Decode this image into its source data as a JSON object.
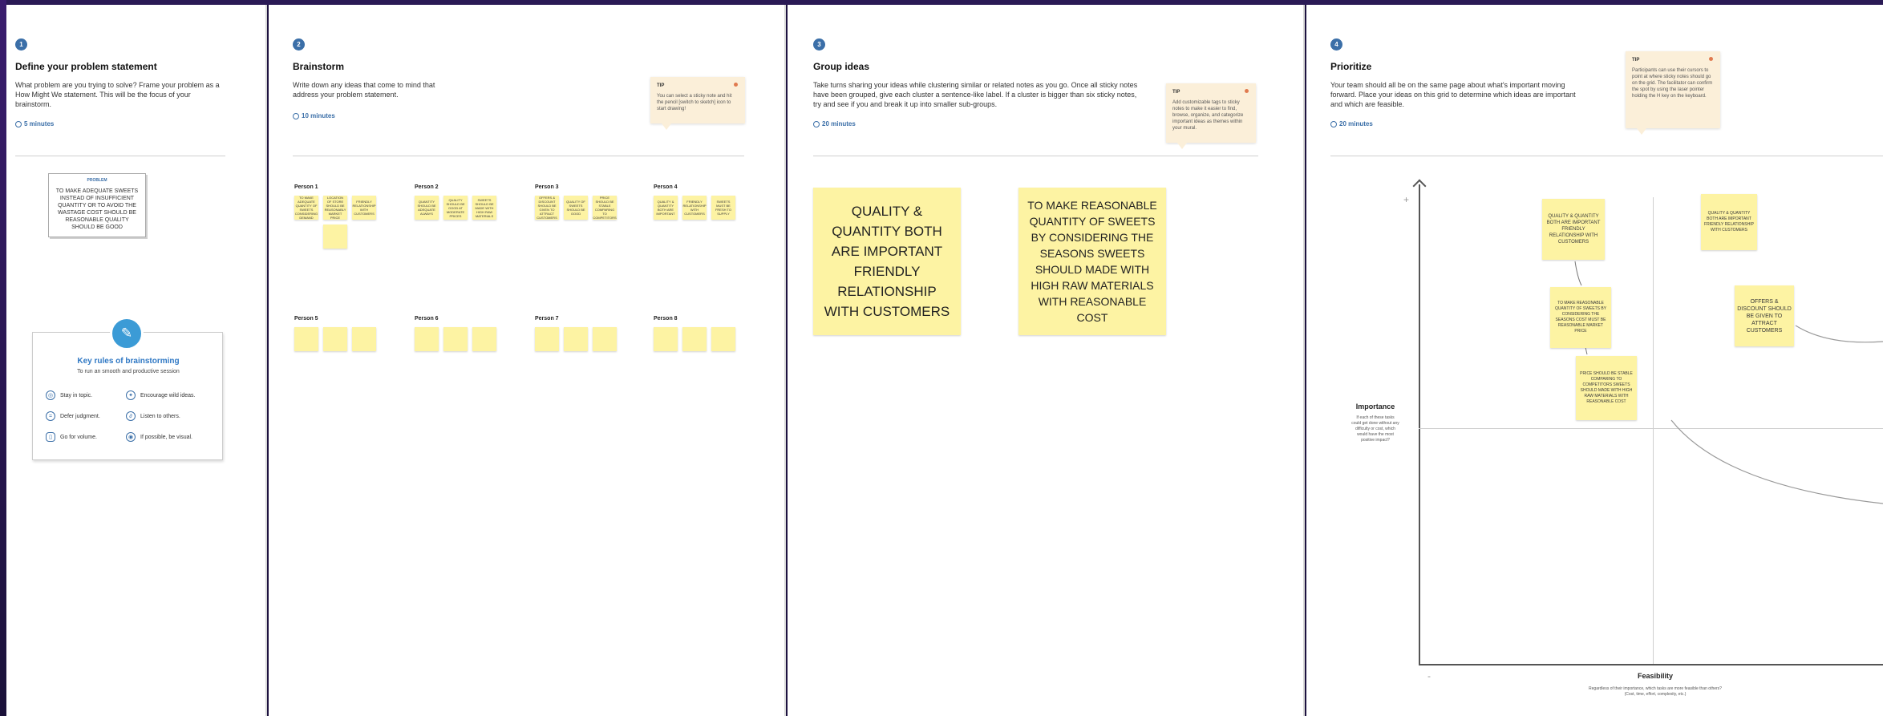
{
  "steps": [
    {
      "number": "1",
      "title": "Define your problem statement",
      "description": "What problem are you trying to solve? Frame your problem as a How Might We statement. This will be the focus of your brainstorm.",
      "time": "5 minutes"
    },
    {
      "number": "2",
      "title": "Brainstorm",
      "description": "Write down any ideas that come to mind that address your problem statement.",
      "time": "10 minutes"
    },
    {
      "number": "3",
      "title": "Group ideas",
      "description": "Take turns sharing your ideas while clustering similar or related notes as you go. Once all sticky notes have been grouped, give each cluster a sentence-like label. If a cluster is bigger than six sticky notes, try and see if you and break it up into smaller sub-groups.",
      "time": "20 minutes"
    },
    {
      "number": "4",
      "title": "Prioritize",
      "description": "Your team should all be on the same page about what's important moving forward. Place your ideas on this grid to determine which ideas are important and which are feasible.",
      "time": "20 minutes"
    }
  ],
  "problem_card": {
    "label": "PROBLEM",
    "text": "TO MAKE ADEQUATE SWEETS INSTEAD OF INSUFFICIENT QUANTITY OR TO AVOID THE WASTAGE COST SHOULD BE REASONABLE QUALITY SHOULD BE GOOD"
  },
  "key_rules": {
    "title": "Key rules of brainstorming",
    "subtitle": "To run an smooth and productive session",
    "rules": [
      {
        "icon": "focus-icon",
        "text": "Stay in topic."
      },
      {
        "icon": "lightbulb-icon",
        "text": "Encourage wild ideas."
      },
      {
        "icon": "pause-icon",
        "text": "Defer judgment."
      },
      {
        "icon": "ear-icon",
        "text": "Listen to others."
      },
      {
        "icon": "volume-icon",
        "text": "Go for volume."
      },
      {
        "icon": "eye-icon",
        "text": "If possible, be visual."
      }
    ]
  },
  "tips": {
    "brainstorm": {
      "label": "TIP",
      "text": "You can select a sticky note and hit the pencil [switch to sketch] icon to start drawing!"
    },
    "group": {
      "label": "TIP",
      "text": "Add customizable tags to sticky notes to make it easier to find, browse, organize, and categorize important ideas as themes within your mural."
    },
    "prioritize": {
      "label": "TIP",
      "text": "Participants can use their cursors to point at where sticky notes should go on the grid. The facilitator can confirm the spot by using the laser pointer holding the H key on the keyboard."
    }
  },
  "persons": [
    {
      "name": "Person 1",
      "notes": [
        "TO MAKE ADEQUATE QUANTITY OF SWEETS CONSIDERING DEMAND",
        "LOCATION OF STORE SHOULD BE REASONABLY MARKET PRICE",
        "FRIENDLY RELATIONSHIP WITH CUSTOMERS",
        ""
      ]
    },
    {
      "name": "Person 2",
      "notes": [
        "QUANTITY SHOULD BE ADEQUATE ALWAYS",
        "QUALITY SHOULD BE GOOD AT MODERATE PRICES",
        "SWEETS SHOULD BE MADE WITH HIGH RAW MATERIALS"
      ]
    },
    {
      "name": "Person 3",
      "notes": [
        "OFFERS & DISCOUNT SHOULD BE GIVEN TO ATTRACT CUSTOMERS",
        "QUALITY OF SWEETS SHOULD BE GOOD",
        "PRICE SHOULD BE STABLE COMPARING TO COMPETITORS"
      ]
    },
    {
      "name": "Person 4",
      "notes": [
        "QUALITY & QUANTITY BOTH ARE IMPORTANT",
        "FRIENDLY RELATIONSHIP WITH CUSTOMERS",
        "SWEETS MUST BE FRESH TO SUPPLY"
      ]
    },
    {
      "name": "Person 5",
      "notes": [
        "",
        "",
        ""
      ]
    },
    {
      "name": "Person 6",
      "notes": [
        "",
        "",
        ""
      ]
    },
    {
      "name": "Person 7",
      "notes": [
        "",
        "",
        ""
      ]
    },
    {
      "name": "Person 8",
      "notes": [
        "",
        "",
        ""
      ]
    }
  ],
  "groups": [
    "QUALITY & QUANTITY BOTH ARE IMPORTANT FRIENDLY RELATIONSHIP WITH CUSTOMERS",
    "TO MAKE REASONABLE QUANTITY OF SWEETS BY CONSIDERING THE SEASONS SWEETS SHOULD MADE WITH HIGH RAW MATERIALS WITH REASONABLE COST"
  ],
  "grid_notes": [
    "QUALITY & QUANTITY BOTH ARE IMPORTANT FRIENDLY RELATIONSHIP WITH CUSTOMERS",
    "TO MAKE REASONABLE QUANTITY OF SWEETS BY CONSIDERING THE SEASONS COST MUST BE REASONABLE MARKET PRICE",
    "PRICE SHOULD BE STABLE COMPARING TO COMPETITORS SWEETS SHOULD MADE WITH HIGH RAW MATERIALS WITH REASONABLE COST",
    "QUALITY & QUANTITY BOTH ARE IMPORTANT FRIENDLY RELATIONSHIP WITH CUSTOMERS",
    "OFFERS & DISCOUNT SHOULD BE GIVEN TO ATTRACT CUSTOMERS"
  ],
  "grid": {
    "y_label": "Importance",
    "y_desc": "If each of these tasks could get done without any difficulty or cost, which would have the most positive impact?",
    "x_label": "Feasibility",
    "x_desc": "Regardless of their importance, which tasks are more feasible than others? (Cost, time, effort, complexity, etc.)",
    "plus": "+",
    "minus": "-"
  },
  "colors": {
    "accent": "#3b6fa8",
    "sticky": "#fdf3a3",
    "tip": "#fbefd9",
    "background": "#1d1240"
  }
}
